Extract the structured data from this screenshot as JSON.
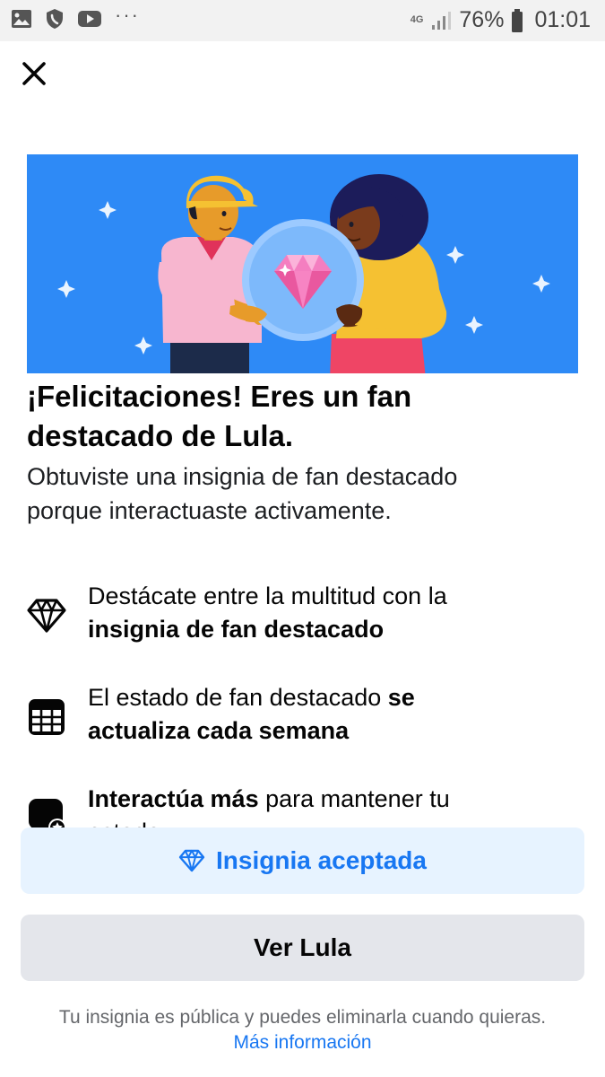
{
  "status_bar": {
    "network": "4G",
    "battery": "76%",
    "time": "01:01"
  },
  "dialog": {
    "close_icon": "close-icon",
    "heading_line1": "¡Felicitaciones! Eres un fan",
    "heading_line2": "destacado de Lula.",
    "subtext_line1": "Obtuviste una insignia de fan destacado",
    "subtext_line2": "porque interactuaste activamente.",
    "features": [
      {
        "icon": "diamond-icon",
        "line1_plain": "Destácate entre la multitud con la",
        "line2_bold": "insignia de fan destacado"
      },
      {
        "icon": "calendar-icon",
        "line1_plain": "El estado de fan destacado ",
        "line1_bold": "se",
        "line2_bold": "actualiza cada semana"
      },
      {
        "icon": "chat-star-icon",
        "line1_bold": "Interactúa más",
        "line1_plain": " para mantener tu",
        "line2_plain": "estado"
      }
    ],
    "accepted_button": "Insignia aceptada",
    "view_button": "Ver Lula",
    "footer_note": "Tu insignia es pública y puedes eliminarla cuando quieras.",
    "footer_link": "Más información"
  },
  "colors": {
    "hero_bg": "#2e8af6",
    "accent": "#1877f2",
    "accepted_bg": "#e7f3ff",
    "secondary_bg": "#e4e6eb"
  }
}
